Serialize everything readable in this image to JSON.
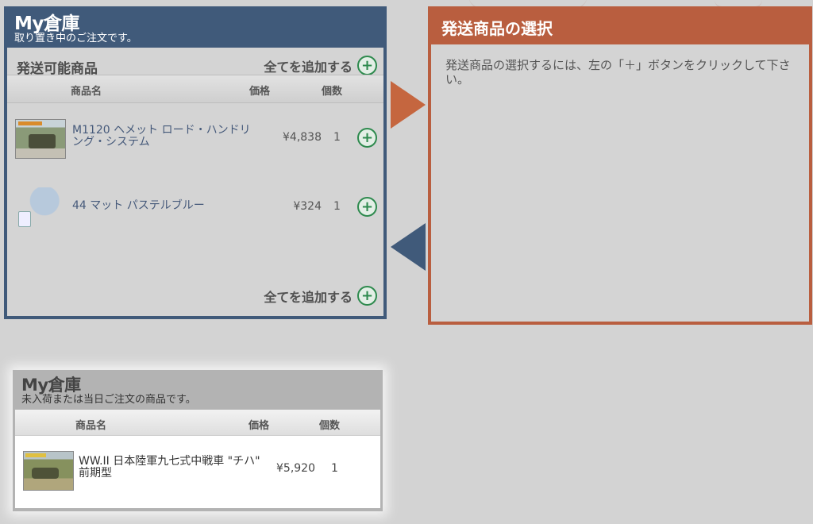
{
  "warehouse": {
    "title": "My倉庫",
    "subtitle": "取り置き中のご注文です。",
    "section_title": "発送可能商品",
    "add_all_label": "全てを追加する",
    "columns": {
      "name": "商品名",
      "price": "価格",
      "qty": "個数"
    },
    "items": [
      {
        "name": "M1120 ヘメット ロード・ハンドリング・システム",
        "price": "¥4,838",
        "qty": "1",
        "thumb_icon": "model-kit-box-icon"
      },
      {
        "name": "44 マット パステルブルー",
        "price": "¥324",
        "qty": "1",
        "thumb_icon": "paint-jar-icon"
      }
    ]
  },
  "shipping": {
    "title": "発送商品の選択",
    "message": "発送商品の選択するには、左の「＋」ボタンをクリックして下さい。"
  },
  "unshipped": {
    "title": "My倉庫",
    "subtitle": "未入荷または当日ご注文の商品です。",
    "columns": {
      "name": "商品名",
      "price": "価格",
      "qty": "個数"
    },
    "items": [
      {
        "name": "WW.II 日本陸軍九七式中戦車 \"チハ\" 前期型",
        "price": "¥5,920",
        "qty": "1",
        "thumb_icon": "tank-kit-box-icon"
      }
    ]
  },
  "colors": {
    "warehouse_blue": "#405a7a",
    "shipping_orange": "#b95e3f",
    "add_green": "#2e8a4e"
  }
}
